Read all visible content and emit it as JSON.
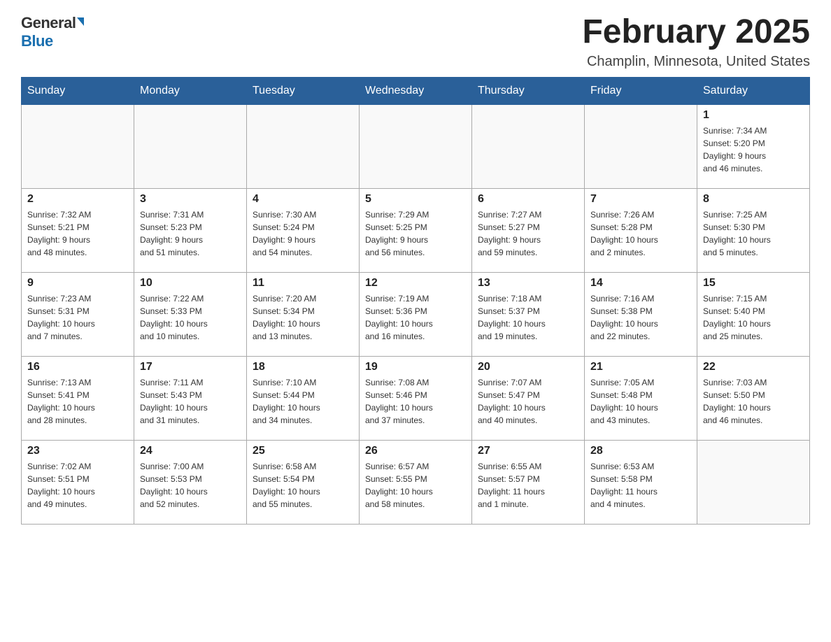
{
  "header": {
    "logo_general": "General",
    "logo_blue": "Blue",
    "month_title": "February 2025",
    "location": "Champlin, Minnesota, United States"
  },
  "weekdays": [
    "Sunday",
    "Monday",
    "Tuesday",
    "Wednesday",
    "Thursday",
    "Friday",
    "Saturday"
  ],
  "weeks": [
    [
      {
        "day": "",
        "info": ""
      },
      {
        "day": "",
        "info": ""
      },
      {
        "day": "",
        "info": ""
      },
      {
        "day": "",
        "info": ""
      },
      {
        "day": "",
        "info": ""
      },
      {
        "day": "",
        "info": ""
      },
      {
        "day": "1",
        "info": "Sunrise: 7:34 AM\nSunset: 5:20 PM\nDaylight: 9 hours\nand 46 minutes."
      }
    ],
    [
      {
        "day": "2",
        "info": "Sunrise: 7:32 AM\nSunset: 5:21 PM\nDaylight: 9 hours\nand 48 minutes."
      },
      {
        "day": "3",
        "info": "Sunrise: 7:31 AM\nSunset: 5:23 PM\nDaylight: 9 hours\nand 51 minutes."
      },
      {
        "day": "4",
        "info": "Sunrise: 7:30 AM\nSunset: 5:24 PM\nDaylight: 9 hours\nand 54 minutes."
      },
      {
        "day": "5",
        "info": "Sunrise: 7:29 AM\nSunset: 5:25 PM\nDaylight: 9 hours\nand 56 minutes."
      },
      {
        "day": "6",
        "info": "Sunrise: 7:27 AM\nSunset: 5:27 PM\nDaylight: 9 hours\nand 59 minutes."
      },
      {
        "day": "7",
        "info": "Sunrise: 7:26 AM\nSunset: 5:28 PM\nDaylight: 10 hours\nand 2 minutes."
      },
      {
        "day": "8",
        "info": "Sunrise: 7:25 AM\nSunset: 5:30 PM\nDaylight: 10 hours\nand 5 minutes."
      }
    ],
    [
      {
        "day": "9",
        "info": "Sunrise: 7:23 AM\nSunset: 5:31 PM\nDaylight: 10 hours\nand 7 minutes."
      },
      {
        "day": "10",
        "info": "Sunrise: 7:22 AM\nSunset: 5:33 PM\nDaylight: 10 hours\nand 10 minutes."
      },
      {
        "day": "11",
        "info": "Sunrise: 7:20 AM\nSunset: 5:34 PM\nDaylight: 10 hours\nand 13 minutes."
      },
      {
        "day": "12",
        "info": "Sunrise: 7:19 AM\nSunset: 5:36 PM\nDaylight: 10 hours\nand 16 minutes."
      },
      {
        "day": "13",
        "info": "Sunrise: 7:18 AM\nSunset: 5:37 PM\nDaylight: 10 hours\nand 19 minutes."
      },
      {
        "day": "14",
        "info": "Sunrise: 7:16 AM\nSunset: 5:38 PM\nDaylight: 10 hours\nand 22 minutes."
      },
      {
        "day": "15",
        "info": "Sunrise: 7:15 AM\nSunset: 5:40 PM\nDaylight: 10 hours\nand 25 minutes."
      }
    ],
    [
      {
        "day": "16",
        "info": "Sunrise: 7:13 AM\nSunset: 5:41 PM\nDaylight: 10 hours\nand 28 minutes."
      },
      {
        "day": "17",
        "info": "Sunrise: 7:11 AM\nSunset: 5:43 PM\nDaylight: 10 hours\nand 31 minutes."
      },
      {
        "day": "18",
        "info": "Sunrise: 7:10 AM\nSunset: 5:44 PM\nDaylight: 10 hours\nand 34 minutes."
      },
      {
        "day": "19",
        "info": "Sunrise: 7:08 AM\nSunset: 5:46 PM\nDaylight: 10 hours\nand 37 minutes."
      },
      {
        "day": "20",
        "info": "Sunrise: 7:07 AM\nSunset: 5:47 PM\nDaylight: 10 hours\nand 40 minutes."
      },
      {
        "day": "21",
        "info": "Sunrise: 7:05 AM\nSunset: 5:48 PM\nDaylight: 10 hours\nand 43 minutes."
      },
      {
        "day": "22",
        "info": "Sunrise: 7:03 AM\nSunset: 5:50 PM\nDaylight: 10 hours\nand 46 minutes."
      }
    ],
    [
      {
        "day": "23",
        "info": "Sunrise: 7:02 AM\nSunset: 5:51 PM\nDaylight: 10 hours\nand 49 minutes."
      },
      {
        "day": "24",
        "info": "Sunrise: 7:00 AM\nSunset: 5:53 PM\nDaylight: 10 hours\nand 52 minutes."
      },
      {
        "day": "25",
        "info": "Sunrise: 6:58 AM\nSunset: 5:54 PM\nDaylight: 10 hours\nand 55 minutes."
      },
      {
        "day": "26",
        "info": "Sunrise: 6:57 AM\nSunset: 5:55 PM\nDaylight: 10 hours\nand 58 minutes."
      },
      {
        "day": "27",
        "info": "Sunrise: 6:55 AM\nSunset: 5:57 PM\nDaylight: 11 hours\nand 1 minute."
      },
      {
        "day": "28",
        "info": "Sunrise: 6:53 AM\nSunset: 5:58 PM\nDaylight: 11 hours\nand 4 minutes."
      },
      {
        "day": "",
        "info": ""
      }
    ]
  ]
}
